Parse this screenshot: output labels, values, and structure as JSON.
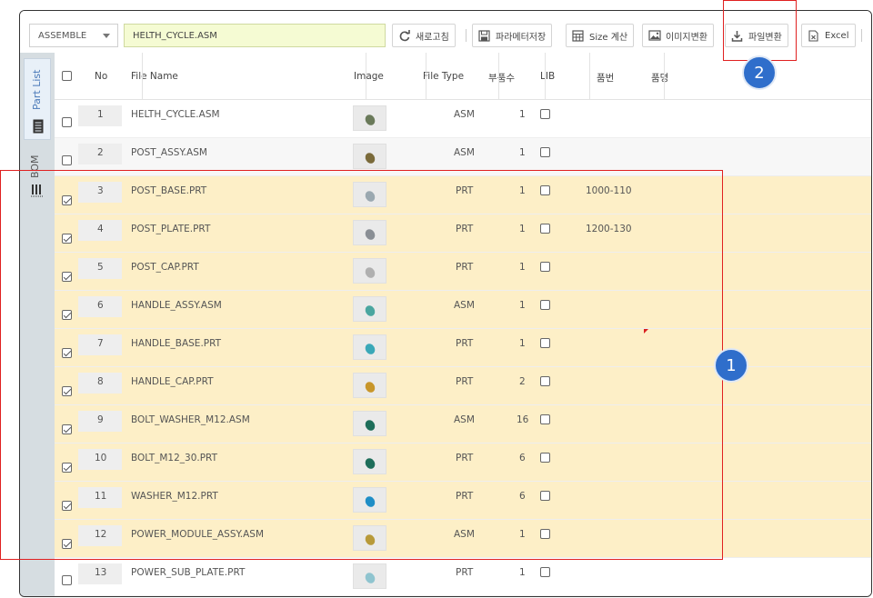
{
  "toolbar": {
    "type_select": "ASSEMBLE",
    "filename": "HELTH_CYCLE.ASM",
    "buttons": {
      "refresh": "새로고침",
      "save_params": "파라메터저장",
      "size_calc": "Size 계산",
      "image_convert": "이미지변환",
      "file_convert": "파일변환",
      "excel": "Excel"
    },
    "icons": {
      "refresh": "refresh-icon",
      "save_params": "save-icon",
      "size_calc": "calculator-icon",
      "image_convert": "image-icon",
      "file_convert": "download-icon",
      "excel": "excel-icon"
    }
  },
  "sidetabs": {
    "part_list": "Part List",
    "bom": "BOM"
  },
  "columns": {
    "no": "No",
    "file_name": "File Name",
    "image": "Image",
    "file_type": "File Type",
    "qty": "부품수",
    "lib": "LIB",
    "part_no": "품번",
    "part_name": "품명"
  },
  "rows": [
    {
      "no": "1",
      "name": "HELTH_CYCLE.ASM",
      "type": "ASM",
      "qty": "1",
      "part_no": "",
      "checked": false,
      "thumb_color": "#6a7a5a"
    },
    {
      "no": "2",
      "name": "POST_ASSY.ASM",
      "type": "ASM",
      "qty": "1",
      "part_no": "",
      "checked": false,
      "thumb_color": "#7a6a3a"
    },
    {
      "no": "3",
      "name": "POST_BASE.PRT",
      "type": "PRT",
      "qty": "1",
      "part_no": "1000-110",
      "checked": true,
      "thumb_color": "#9aa8b0"
    },
    {
      "no": "4",
      "name": "POST_PLATE.PRT",
      "type": "PRT",
      "qty": "1",
      "part_no": "1200-130",
      "checked": true,
      "thumb_color": "#8a8f95"
    },
    {
      "no": "5",
      "name": "POST_CAP.PRT",
      "type": "PRT",
      "qty": "1",
      "part_no": "",
      "checked": true,
      "thumb_color": "#b0b0b0"
    },
    {
      "no": "6",
      "name": "HANDLE_ASSY.ASM",
      "type": "ASM",
      "qty": "1",
      "part_no": "",
      "checked": true,
      "thumb_color": "#4aa6a0"
    },
    {
      "no": "7",
      "name": "HANDLE_BASE.PRT",
      "type": "PRT",
      "qty": "1",
      "part_no": "",
      "checked": true,
      "thumb_color": "#3aa8b8"
    },
    {
      "no": "8",
      "name": "HANDLE_CAP.PRT",
      "type": "PRT",
      "qty": "2",
      "part_no": "",
      "checked": true,
      "thumb_color": "#c8962a"
    },
    {
      "no": "9",
      "name": "BOLT_WASHER_M12.ASM",
      "type": "ASM",
      "qty": "16",
      "part_no": "",
      "checked": true,
      "thumb_color": "#1e6e5a"
    },
    {
      "no": "10",
      "name": "BOLT_M12_30.PRT",
      "type": "PRT",
      "qty": "6",
      "part_no": "",
      "checked": true,
      "thumb_color": "#1e6e5a"
    },
    {
      "no": "11",
      "name": "WASHER_M12.PRT",
      "type": "PRT",
      "qty": "6",
      "part_no": "",
      "checked": true,
      "thumb_color": "#1f8ec6"
    },
    {
      "no": "12",
      "name": "POWER_MODULE_ASSY.ASM",
      "type": "ASM",
      "qty": "1",
      "part_no": "",
      "checked": true,
      "thumb_color": "#b89a3a"
    },
    {
      "no": "13",
      "name": "POWER_SUB_PLATE.PRT",
      "type": "PRT",
      "qty": "1",
      "part_no": "",
      "checked": false,
      "thumb_color": "#8fc4cf"
    }
  ],
  "annotations": {
    "badge_1": "1",
    "badge_2": "2",
    "highlight_color": "#e02020",
    "badge_color": "#2f6ecb"
  }
}
